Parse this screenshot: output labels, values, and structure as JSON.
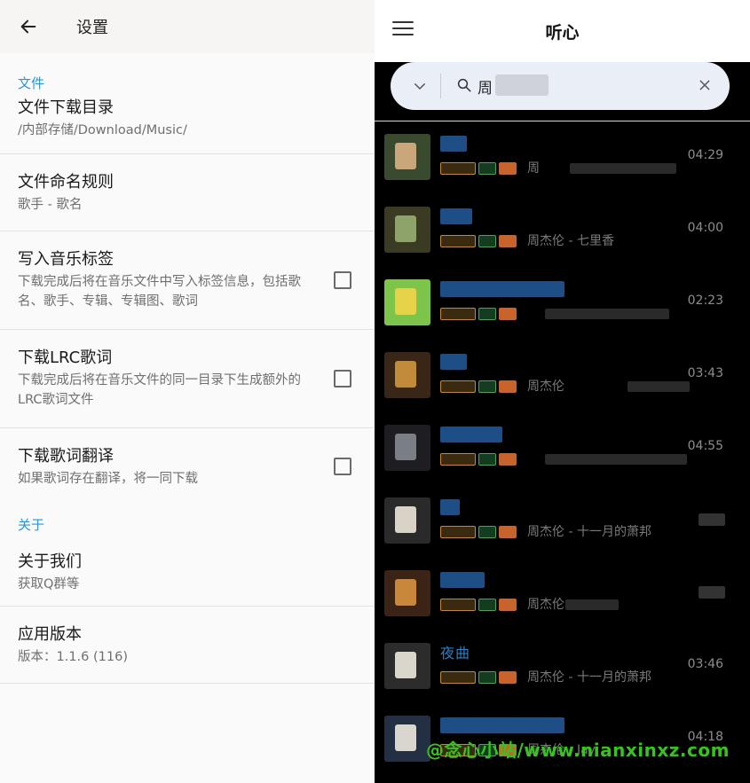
{
  "settings": {
    "header_title": "设置",
    "section_file": "文件",
    "section_about": "关于",
    "items": [
      {
        "title": "文件下载目录",
        "subtitle": "/内部存储/Download/Music/"
      },
      {
        "title": "文件命名规则",
        "subtitle": "歌手 - 歌名"
      },
      {
        "title": "写入音乐标签",
        "subtitle": "下载完成后将在音乐文件中写入标签信息，包括歌名、歌手、专辑、专辑图、歌词",
        "checked": false
      },
      {
        "title": "下载LRC歌词",
        "subtitle": "下载完成后将在音乐文件的同一目录下生成额外的LRC歌词文件",
        "checked": false
      },
      {
        "title": "下载歌词翻译",
        "subtitle": "如果歌词存在翻译，将一同下载",
        "checked": false
      }
    ],
    "about_items": [
      {
        "title": "关于我们",
        "subtitle": "获取Q群等"
      },
      {
        "title": "应用版本",
        "subtitle": "版本：1.1.6 (116)"
      }
    ]
  },
  "player": {
    "app_title": "听心",
    "search_value": "周",
    "icons": {
      "menu": "menu-icon",
      "collapse": "chevron-down-icon",
      "search": "search-icon",
      "clear": "close-icon"
    },
    "songs": [
      {
        "name": "",
        "meta": "周",
        "duration": "04:29"
      },
      {
        "name": "",
        "meta": "周杰伦 - 七里香",
        "duration": "04:00"
      },
      {
        "name": "",
        "meta": "",
        "duration": "02:23"
      },
      {
        "name": "",
        "meta": "周杰伦",
        "duration": "03:43"
      },
      {
        "name": "",
        "meta": "",
        "duration": "04:55"
      },
      {
        "name": "",
        "meta": "周杰伦 - 十一月的萧邦",
        "duration": ""
      },
      {
        "name": "",
        "meta": "周杰伦",
        "duration": ""
      },
      {
        "name": "夜曲",
        "meta": "周杰伦 - 十一月的萧邦",
        "duration": "03:46"
      },
      {
        "name": "",
        "meta": "周杰伦 - Jay",
        "duration": "04:18"
      }
    ],
    "watermark": "@念心小站/www.nianxinxz.com"
  },
  "colors": {
    "accent_blue": "#2f93d8",
    "watermark_green": "#37c21f"
  }
}
